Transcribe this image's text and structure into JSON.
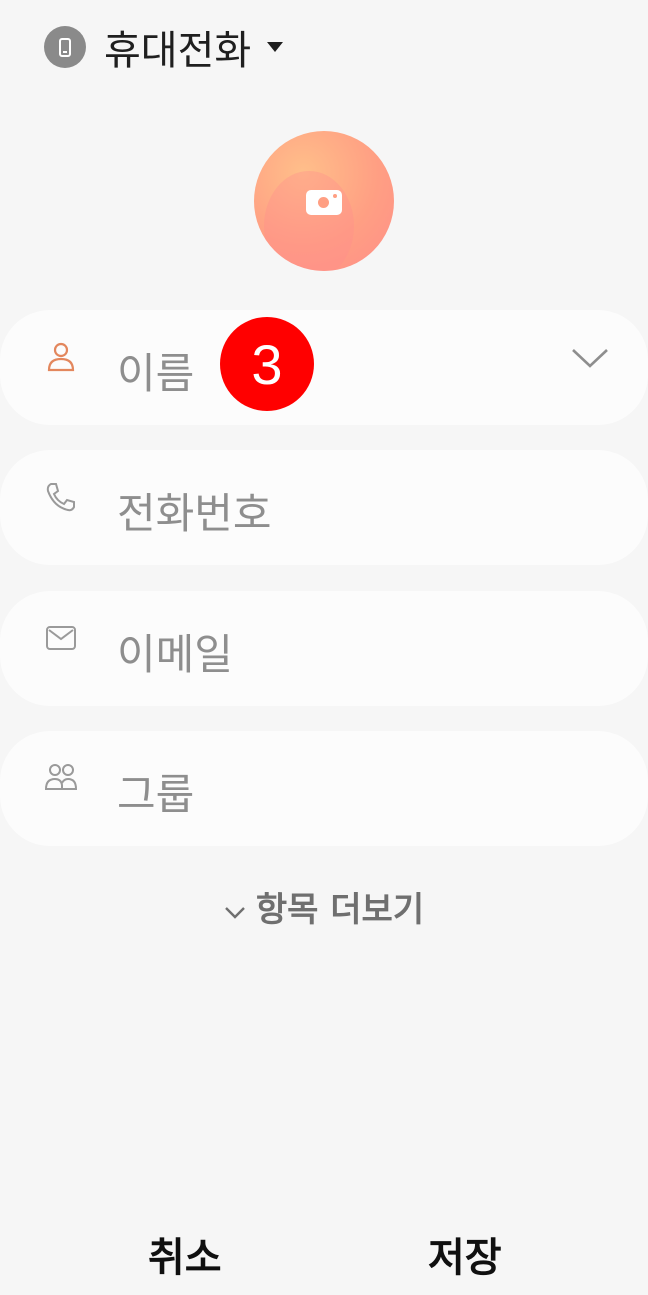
{
  "storage": {
    "label": "휴대전화"
  },
  "fields": [
    {
      "label": "이름",
      "icon": "person-icon"
    },
    {
      "label": "전화번호",
      "icon": "phone-icon"
    },
    {
      "label": "이메일",
      "icon": "mail-icon"
    },
    {
      "label": "그룹",
      "icon": "group-icon"
    }
  ],
  "badge": {
    "text": "3"
  },
  "more_fields": {
    "label": "항목 더보기"
  },
  "actions": {
    "cancel": "취소",
    "save": "저장"
  },
  "colors": {
    "accent": "#e3875d",
    "badge": "#ff0000",
    "background": "#f6f6f6"
  }
}
